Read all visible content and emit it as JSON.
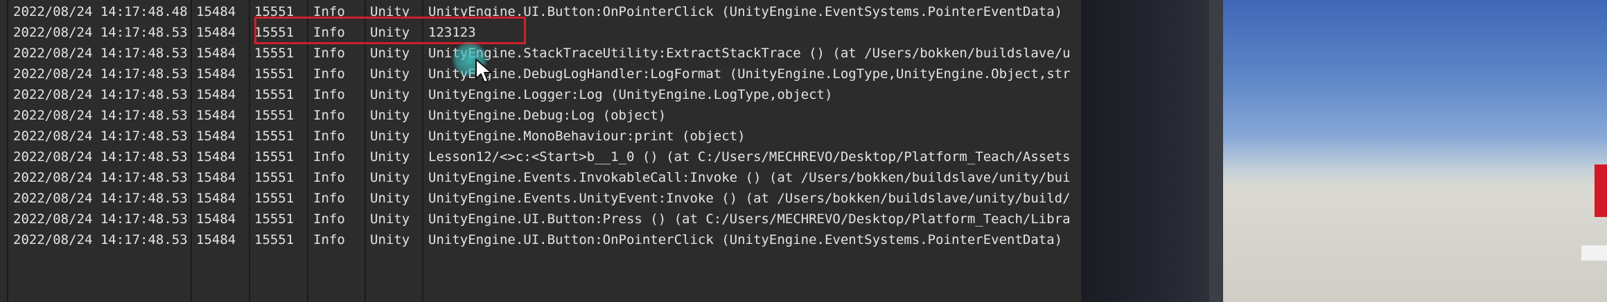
{
  "log": {
    "rows": [
      {
        "date": "2022/08/24 14:17:48.48",
        "pid": "15484",
        "tid": "15551",
        "level": "Info",
        "tag": "Unity",
        "msg": "UnityEngine.UI.Button:OnPointerClick (UnityEngine.EventSystems.PointerEventData)"
      },
      {
        "date": "2022/08/24 14:17:48.53",
        "pid": "15484",
        "tid": "15551",
        "level": "Info",
        "tag": "Unity",
        "msg": "123123"
      },
      {
        "date": "2022/08/24 14:17:48.53",
        "pid": "15484",
        "tid": "15551",
        "level": "Info",
        "tag": "Unity",
        "msg": "UnityEngine.StackTraceUtility:ExtractStackTrace () (at /Users/bokken/buildslave/u"
      },
      {
        "date": "2022/08/24 14:17:48.53",
        "pid": "15484",
        "tid": "15551",
        "level": "Info",
        "tag": "Unity",
        "msg": "UnityEngine.DebugLogHandler:LogFormat (UnityEngine.LogType,UnityEngine.Object,str"
      },
      {
        "date": "2022/08/24 14:17:48.53",
        "pid": "15484",
        "tid": "15551",
        "level": "Info",
        "tag": "Unity",
        "msg": "UnityEngine.Logger:Log (UnityEngine.LogType,object)"
      },
      {
        "date": "2022/08/24 14:17:48.53",
        "pid": "15484",
        "tid": "15551",
        "level": "Info",
        "tag": "Unity",
        "msg": "UnityEngine.Debug:Log (object)"
      },
      {
        "date": "2022/08/24 14:17:48.53",
        "pid": "15484",
        "tid": "15551",
        "level": "Info",
        "tag": "Unity",
        "msg": "UnityEngine.MonoBehaviour:print (object)"
      },
      {
        "date": "2022/08/24 14:17:48.53",
        "pid": "15484",
        "tid": "15551",
        "level": "Info",
        "tag": "Unity",
        "msg": "Lesson12/<>c:<Start>b__1_0 () (at C:/Users/MECHREVO/Desktop/Platform_Teach/Assets"
      },
      {
        "date": "2022/08/24 14:17:48.53",
        "pid": "15484",
        "tid": "15551",
        "level": "Info",
        "tag": "Unity",
        "msg": "UnityEngine.Events.InvokableCall:Invoke () (at /Users/bokken/buildslave/unity/bui"
      },
      {
        "date": "2022/08/24 14:17:48.53",
        "pid": "15484",
        "tid": "15551",
        "level": "Info",
        "tag": "Unity",
        "msg": "UnityEngine.Events.UnityEvent:Invoke () (at /Users/bokken/buildslave/unity/build/"
      },
      {
        "date": "2022/08/24 14:17:48.53",
        "pid": "15484",
        "tid": "15551",
        "level": "Info",
        "tag": "Unity",
        "msg": "UnityEngine.UI.Button:Press () (at C:/Users/MECHREVO/Desktop/Platform_Teach/Libra"
      },
      {
        "date": "2022/08/24 14:17:48.53",
        "pid": "15484",
        "tid": "15551",
        "level": "Info",
        "tag": "Unity",
        "msg": "UnityEngine.UI.Button:OnPointerClick (UnityEngine.EventSystems.PointerEventData)"
      }
    ]
  },
  "colors": {
    "panel_bg": "#2c2c2c",
    "text": "#e4e4e4",
    "highlight_border": "#d0202a",
    "cursor_halo": "#40bebe"
  },
  "icons": {
    "cursor": "mouse-pointer-icon"
  }
}
